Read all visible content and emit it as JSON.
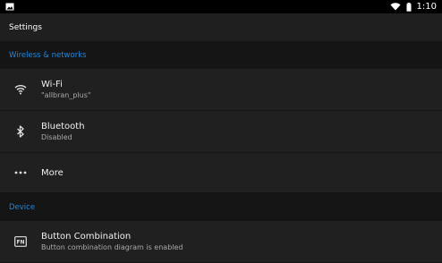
{
  "status_bar": {
    "time": "1:10",
    "icons": [
      "image-icon",
      "wifi-icon",
      "battery-icon"
    ]
  },
  "header": {
    "title": "Settings"
  },
  "sections": [
    {
      "label": "Wireless & networks",
      "items": [
        {
          "icon": "wifi-icon",
          "title": "Wi-Fi",
          "subtitle": "\"allbran_plus\""
        },
        {
          "icon": "bluetooth-icon",
          "title": "Bluetooth",
          "subtitle": "Disabled"
        },
        {
          "icon": "more-icon",
          "title": "More"
        }
      ]
    },
    {
      "label": "Device",
      "items": [
        {
          "icon": "fn-icon",
          "title": "Button Combination",
          "subtitle": "Button combination diagram is enabled"
        }
      ]
    }
  ],
  "colors": {
    "accent": "#1e88e5",
    "background": "#1b1b1b",
    "item_background": "#202020",
    "status_bar": "#000000"
  }
}
